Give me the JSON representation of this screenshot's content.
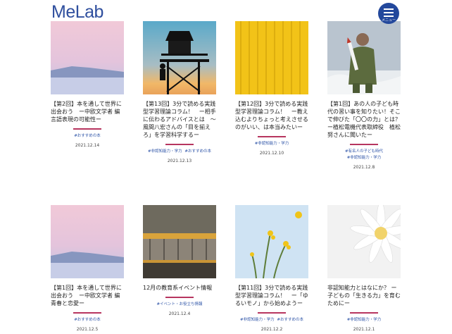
{
  "header": {
    "logo_text": "MeLab",
    "menu_label": "メニュー"
  },
  "articles": [
    {
      "title": "【第2回】本を通して世界に出会おう　ー中欧文学者 編 言語表現の可能性ー",
      "tags": [
        "#おすすめの本"
      ],
      "date": "2021.12.14"
    },
    {
      "title": "【第13回】3分で読める実践型学習理論コラム！　ー相手に伝わるアドバイスとは　～風間八宏さんの「目を揃えろ」を学習科学するー",
      "tags": [
        "#非認知能力・学力",
        "#おすすめの本"
      ],
      "date": "2021.12.13"
    },
    {
      "title": "【第12回】3分で読める実践型学習理論コラム！　ー教え込むよりちょっと考えさせるのがいい、は本当みたいー",
      "tags": [
        "#非認知能力・学力"
      ],
      "date": "2021.12.10"
    },
    {
      "title": "【第1回】あの人の子ども時代の習い事を知りたい！そこで伸びた「〇〇の力」とは？　ー植松電機代表取締役　植松努さんに聞いたー",
      "tags": [
        "#有名人の子ども時代",
        "#非認知能力・学力"
      ],
      "date": "2021.12.8"
    },
    {
      "title": "【第1回】本を通して世界に出会おう　ー中欧文学者 編 青春と恋愛ー",
      "tags": [
        "#おすすめの本"
      ],
      "date": "2021.12.5"
    },
    {
      "title": "12月の教育系イベント情報",
      "tags": [
        "#イベント・お役立ち情報"
      ],
      "date": "2021.12.4"
    },
    {
      "title": "【第11回】3分で読める実践型学習理論コラム！　ー「ゆるいモノ」から始めようー",
      "tags": [
        "#非認知能力・学力",
        "#おすすめの本"
      ],
      "date": "2021.12.2"
    },
    {
      "title": "非認知能力とはなにか？ ー子どもの「生きる力」を育むためにー",
      "tags": [
        "#非認知能力・学力"
      ],
      "date": "2021.12.1"
    }
  ],
  "colors": {
    "brand_blue": "#23489c",
    "accent_pink": "#b7355f",
    "tag_blue": "#2f55a8"
  }
}
